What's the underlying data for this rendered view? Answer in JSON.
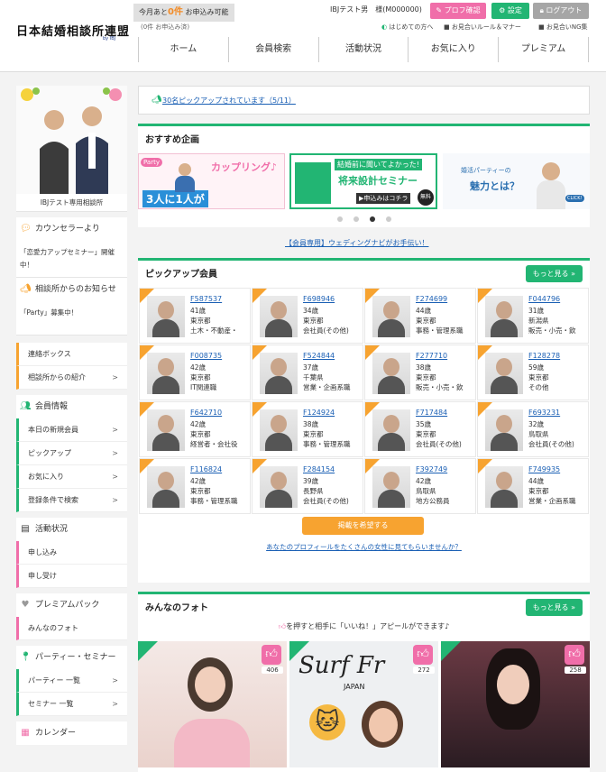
{
  "header": {
    "logo": "日本結婚相談所連盟",
    "logo_sub": "by IBJ",
    "quota_prefix": "今月あと",
    "quota_num": "0件",
    "quota_suffix": " お申込み可能",
    "quota_sub": "(0件 お申込み済)",
    "user_name": "IBJテスト男　様(M000000)",
    "btn_profile": "プロフ確認",
    "btn_settings": "設定",
    "btn_logout": "ログアウト",
    "link_beginner": "はじめての方へ",
    "link_rules": "お見合いルール＆マナー",
    "link_ng": "お見合いNG集"
  },
  "nav": [
    "ホーム",
    "会員検索",
    "活動状況",
    "お気に入り",
    "プレミアム"
  ],
  "sidebar": {
    "agency_name": "IBJテスト専用相談所",
    "counselor_title": "カウンセラーより",
    "counselor_note": "「恋愛力アップセミナー」開催中！",
    "agency_news_title": "相談所からのお知らせ",
    "agency_news_note": "「Party」募集中！",
    "contact_items": [
      "連絡ボックス",
      "相談所からの紹介"
    ],
    "member_info_title": "会員情報",
    "member_items": [
      "本日の新規会員",
      "ピックアップ",
      "お気に入り",
      "登録条件で検索"
    ],
    "activity_title": "活動状況",
    "activity_items": [
      "申し込み",
      "申し受け"
    ],
    "premium_title": "プレミアムパック",
    "premium_items": [
      "みんなのフォト"
    ],
    "party_title": "パーティー・セミナー",
    "party_items": [
      "パーティー 一覧",
      "セミナー 一覧"
    ],
    "calendar_title": "カレンダー"
  },
  "main": {
    "pickup_notice": "30名ピックアップされています（5/11）",
    "recommend_title": "おすすめ企画",
    "banner1_tag": "Party",
    "banner1_title": "カップリング♪",
    "banner1_sub": "3人に1人が",
    "banner2_title": "結婚前に聞いてよかった!",
    "banner2_sub": "将来設計セミナー",
    "banner2_cta": "▶申込みはコチラ",
    "banner2_badge": "無料",
    "banner3_title": "婚活パーティーの",
    "banner3_sub": "魅力とは？",
    "banner3_click": "CLICK!",
    "wedding_link": "【会員専用】ウェディングナビがお手伝い！",
    "pickup_title": "ピックアップ会員",
    "more_label": "もっと見る »",
    "cta_button": "掲載を希望する",
    "cta_link": "あなたのプロフィールをたくさんの女性に見てもらいませんか？",
    "photos_title": "みんなのフォト",
    "photos_more": "もっと見る »",
    "photos_hint": "を押すと相手に「いいね！」アピールができます♪",
    "photo_likes": [
      "406",
      "272",
      "258"
    ],
    "photo2_text": "Surf Fr",
    "photo2_sub": "JAPAN"
  },
  "members": [
    {
      "id": "F587537",
      "age": "41歳",
      "area": "東京都",
      "job": "土木・不動産・"
    },
    {
      "id": "F698946",
      "age": "34歳",
      "area": "東京都",
      "job": "会社員(その他)"
    },
    {
      "id": "F274699",
      "age": "44歳",
      "area": "東京都",
      "job": "事務・管理系職"
    },
    {
      "id": "F044796",
      "age": "31歳",
      "area": "新潟県",
      "job": "販売・小売・飲"
    },
    {
      "id": "F008735",
      "age": "42歳",
      "area": "東京都",
      "job": "IT関連職"
    },
    {
      "id": "F524844",
      "age": "37歳",
      "area": "千葉県",
      "job": "営業・企画系職"
    },
    {
      "id": "F277710",
      "age": "38歳",
      "area": "東京都",
      "job": "販売・小売・飲"
    },
    {
      "id": "F128278",
      "age": "59歳",
      "area": "東京都",
      "job": "その他"
    },
    {
      "id": "F642710",
      "age": "42歳",
      "area": "東京都",
      "job": "経営者・会社役"
    },
    {
      "id": "F124924",
      "age": "38歳",
      "area": "東京都",
      "job": "事務・管理系職"
    },
    {
      "id": "F717484",
      "age": "35歳",
      "area": "東京都",
      "job": "会社員(その他)"
    },
    {
      "id": "F693231",
      "age": "32歳",
      "area": "鳥取県",
      "job": "会社員(その他)"
    },
    {
      "id": "F116824",
      "age": "42歳",
      "area": "東京都",
      "job": "事務・管理系職"
    },
    {
      "id": "F284154",
      "age": "39歳",
      "area": "長野県",
      "job": "会社員(その他)"
    },
    {
      "id": "F392749",
      "age": "42歳",
      "area": "鳥取県",
      "job": "地方公務員"
    },
    {
      "id": "F749935",
      "age": "44歳",
      "area": "東京都",
      "job": "営業・企画系職"
    }
  ],
  "colors": {
    "accent_green": "#22b573",
    "accent_pink": "#f06ea9",
    "accent_orange": "#f7a330",
    "link_blue": "#1a5fb4"
  }
}
